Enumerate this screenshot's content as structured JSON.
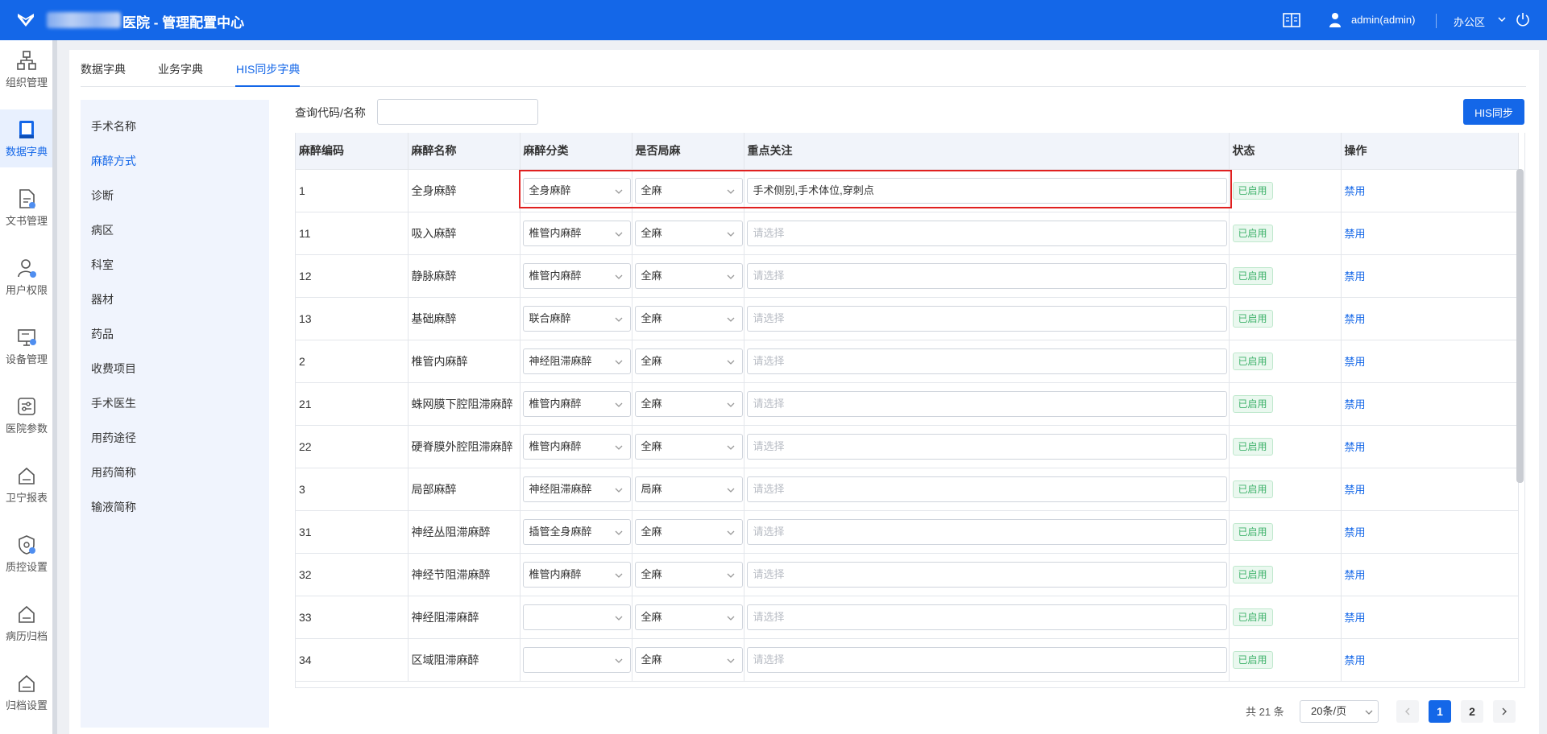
{
  "header": {
    "title": "医院 - 管理配置中心",
    "user": "admin(admin)",
    "office": "办公区"
  },
  "rail": [
    {
      "label": "组织管理",
      "icon": "org-icon"
    },
    {
      "label": "数据字典",
      "icon": "book-icon"
    },
    {
      "label": "文书管理",
      "icon": "document-icon"
    },
    {
      "label": "用户权限",
      "icon": "user-icon"
    },
    {
      "label": "设备管理",
      "icon": "monitor-icon"
    },
    {
      "label": "医院参数",
      "icon": "sliders-icon"
    },
    {
      "label": "卫宁报表",
      "icon": "report-icon"
    },
    {
      "label": "质控设置",
      "icon": "shield-icon"
    },
    {
      "label": "病历归档",
      "icon": "archive-icon"
    },
    {
      "label": "归档设置",
      "icon": "archive-settings-icon"
    }
  ],
  "tabs": [
    "数据字典",
    "业务字典",
    "HIS同步字典"
  ],
  "subnav": [
    "手术名称",
    "麻醉方式",
    "诊断",
    "病区",
    "科室",
    "器材",
    "药品",
    "收费项目",
    "手术医生",
    "用药途径",
    "用药简称",
    "输液简称"
  ],
  "query": {
    "label": "查询代码/名称",
    "value": "",
    "button": "HIS同步"
  },
  "table": {
    "headers": [
      "麻醉编码",
      "麻醉名称",
      "麻醉分类",
      "是否局麻",
      "重点关注",
      "状态",
      "操作"
    ],
    "placeholder": "请选择",
    "rows": [
      {
        "code": "1",
        "name": "全身麻醉",
        "category": "全身麻醉",
        "local": "全麻",
        "focus": "手术侧别,手术体位,穿刺点",
        "status": "已启用",
        "action": "禁用"
      },
      {
        "code": "11",
        "name": "吸入麻醉",
        "category": "椎管内麻醉",
        "local": "全麻",
        "focus": "",
        "status": "已启用",
        "action": "禁用"
      },
      {
        "code": "12",
        "name": "静脉麻醉",
        "category": "椎管内麻醉",
        "local": "全麻",
        "focus": "",
        "status": "已启用",
        "action": "禁用"
      },
      {
        "code": "13",
        "name": "基础麻醉",
        "category": "联合麻醉",
        "local": "全麻",
        "focus": "",
        "status": "已启用",
        "action": "禁用"
      },
      {
        "code": "2",
        "name": "椎管内麻醉",
        "category": "神经阻滞麻醉",
        "local": "全麻",
        "focus": "",
        "status": "已启用",
        "action": "禁用"
      },
      {
        "code": "21",
        "name": "蛛网膜下腔阻滞麻醉",
        "category": "椎管内麻醉",
        "local": "全麻",
        "focus": "",
        "status": "已启用",
        "action": "禁用"
      },
      {
        "code": "22",
        "name": "硬脊膜外腔阻滞麻醉",
        "category": "椎管内麻醉",
        "local": "全麻",
        "focus": "",
        "status": "已启用",
        "action": "禁用"
      },
      {
        "code": "3",
        "name": "局部麻醉",
        "category": "神经阻滞麻醉",
        "local": "局麻",
        "focus": "",
        "status": "已启用",
        "action": "禁用"
      },
      {
        "code": "31",
        "name": "神经丛阻滞麻醉",
        "category": "插管全身麻醉",
        "local": "全麻",
        "focus": "",
        "status": "已启用",
        "action": "禁用"
      },
      {
        "code": "32",
        "name": "神经节阻滞麻醉",
        "category": "椎管内麻醉",
        "local": "全麻",
        "focus": "",
        "status": "已启用",
        "action": "禁用"
      },
      {
        "code": "33",
        "name": "神经阻滞麻醉",
        "category": "",
        "local": "全麻",
        "focus": "",
        "status": "已启用",
        "action": "禁用"
      },
      {
        "code": "34",
        "name": "区域阻滞麻醉",
        "category": "",
        "local": "全麻",
        "focus": "",
        "status": "已启用",
        "action": "禁用"
      }
    ]
  },
  "pagination": {
    "total": "共 21 条",
    "page_size": "20条/页",
    "pages": [
      "1",
      "2"
    ],
    "current": "1"
  },
  "colors": {
    "primary": "#1467e8",
    "success": "#3fb26b",
    "highlight": "#e02020"
  }
}
